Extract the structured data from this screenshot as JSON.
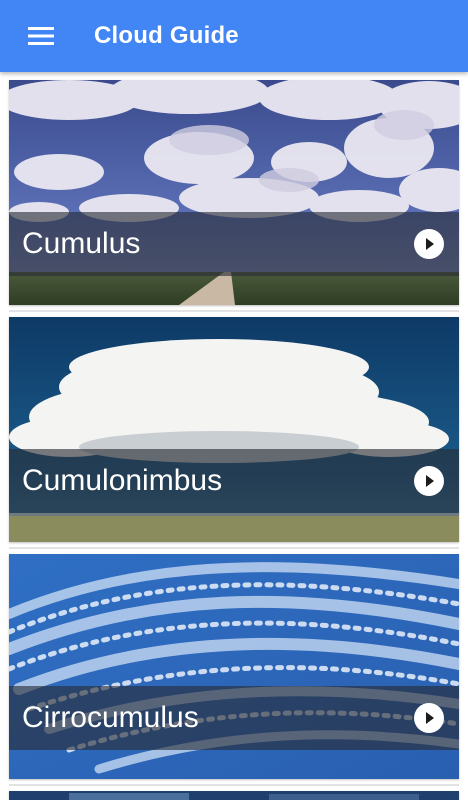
{
  "app_bar": {
    "title": "Cloud Guide",
    "menu_icon": "hamburger-menu-icon",
    "color": "#4285f4"
  },
  "clouds": [
    {
      "label": "Cumulus",
      "action_icon": "play-circle-icon"
    },
    {
      "label": "Cumulonimbus",
      "action_icon": "play-circle-icon"
    },
    {
      "label": "Cirrocumulus",
      "action_icon": "play-circle-icon"
    }
  ]
}
